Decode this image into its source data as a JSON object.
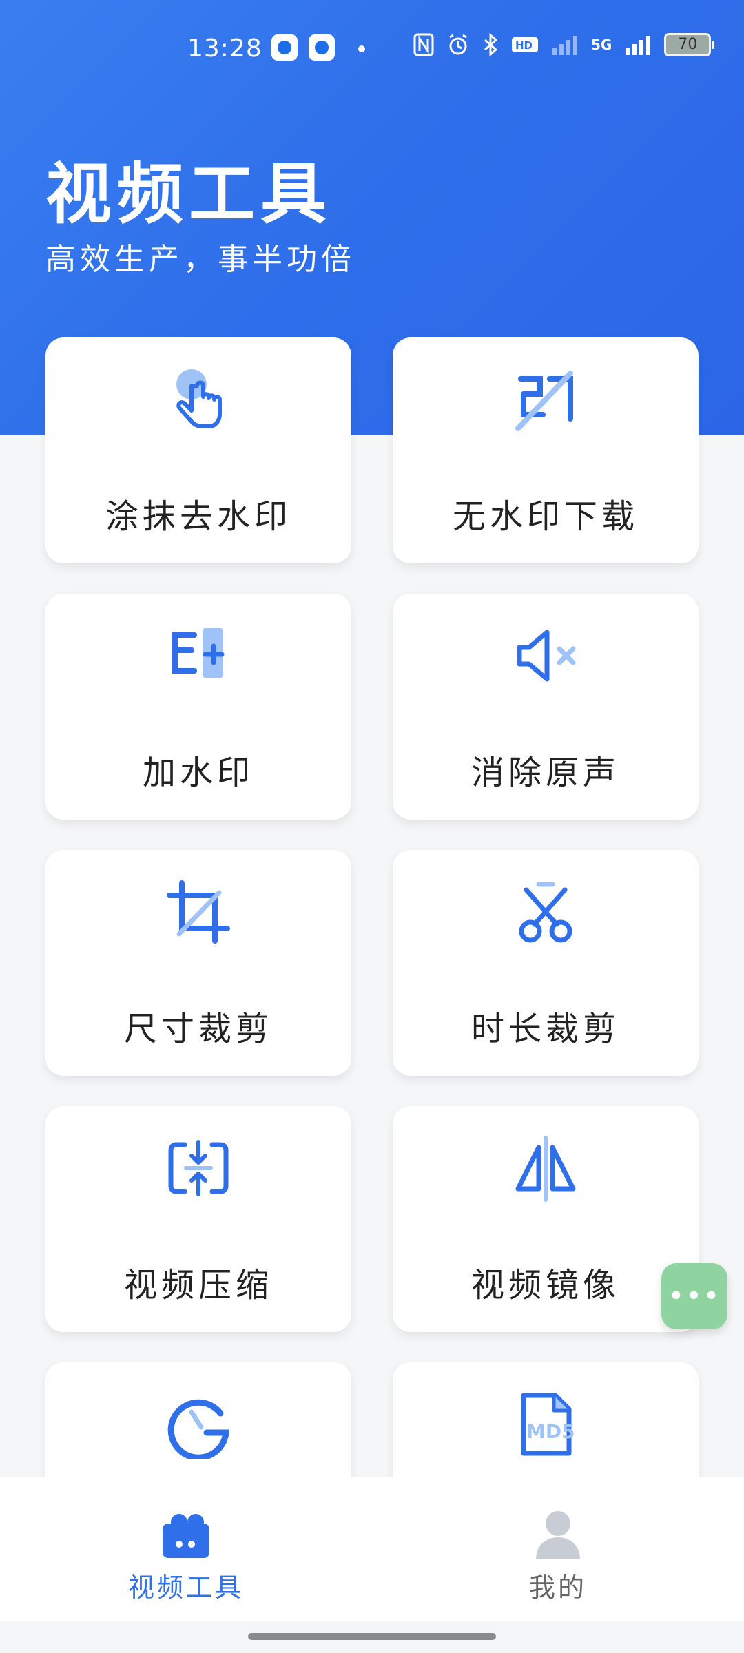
{
  "colors": {
    "accent": "#2f6fea",
    "icon_blue": "#2f6fea",
    "icon_light": "#9fc3f7",
    "float_green": "#8fd4a0",
    "text": "#222222",
    "nav_inactive": "#666666"
  },
  "status_bar": {
    "time": "13:28",
    "battery": "70",
    "network": "5G"
  },
  "header": {
    "title": "视频工具",
    "subtitle": "高效生产，事半功倍"
  },
  "tools": [
    {
      "label": "涂抹去水印",
      "icon": "tap-hand-icon"
    },
    {
      "label": "无水印下载",
      "icon": "no-watermark-icon"
    },
    {
      "label": "加水印",
      "icon": "add-watermark-icon"
    },
    {
      "label": "消除原声",
      "icon": "mute-icon"
    },
    {
      "label": "尺寸裁剪",
      "icon": "crop-icon"
    },
    {
      "label": "时长裁剪",
      "icon": "scissors-icon"
    },
    {
      "label": "视频压缩",
      "icon": "compress-icon"
    },
    {
      "label": "视频镜像",
      "icon": "mirror-icon"
    },
    {
      "label": "",
      "icon": "speed-gauge-icon"
    },
    {
      "label": "MD5",
      "icon": "md5-file-icon"
    }
  ],
  "bottom_nav": [
    {
      "label": "视频工具",
      "icon": "video-camera-icon",
      "active": true
    },
    {
      "label": "我的",
      "icon": "user-icon",
      "active": false
    }
  ],
  "float_button": {
    "icon": "more-dots-icon"
  }
}
